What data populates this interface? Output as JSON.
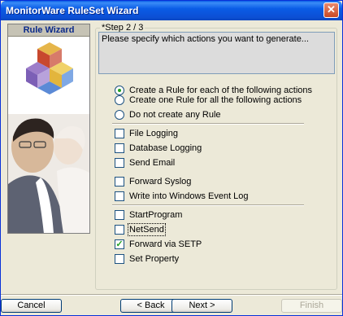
{
  "window": {
    "title": "MonitorWare RuleSet Wizard",
    "close_glyph": "✕"
  },
  "sidebar": {
    "header": "Rule Wizard",
    "logo_icon": "cubes-logo-icon"
  },
  "step": {
    "legend": "*Step 2 / 3",
    "description": "Please specify which actions you want to generate..."
  },
  "radios": [
    {
      "label": "Create a Rule for each of the following actions",
      "selected": true
    },
    {
      "label": "Create one Rule for all the following actions",
      "selected": false
    },
    {
      "label": "Do not create any Rule",
      "selected": false
    }
  ],
  "actions_group1": [
    {
      "label": "File Logging",
      "checked": false
    },
    {
      "label": "Database Logging",
      "checked": false
    },
    {
      "label": "Send Email",
      "checked": false
    }
  ],
  "actions_group2": [
    {
      "label": "Forward Syslog",
      "checked": false
    },
    {
      "label": "Write into Windows Event Log",
      "checked": false
    }
  ],
  "actions_group3": [
    {
      "label": "StartProgram",
      "checked": false
    },
    {
      "label": "NetSend",
      "checked": false
    },
    {
      "label": "Forward via SETP",
      "checked": true
    },
    {
      "label": "Set Property",
      "checked": false
    }
  ],
  "buttons": {
    "cancel": "Cancel",
    "back": "< Back",
    "next": "Next >",
    "finish": "Finish"
  },
  "colors": {
    "titlebar": "#0a5ce6",
    "check_mark": "#21a121",
    "window_bg": "#ece9d8"
  }
}
